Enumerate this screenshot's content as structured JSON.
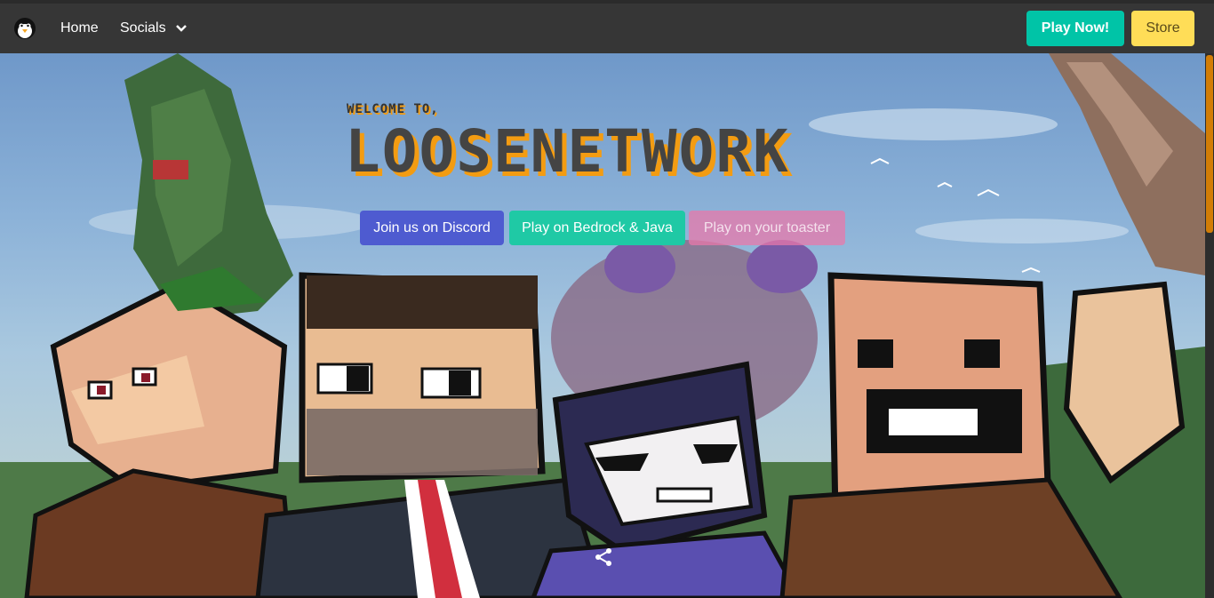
{
  "navbar": {
    "logo_icon": "penguin-logo-icon",
    "home_label": "Home",
    "socials_label": "Socials",
    "play_now_label": "Play Now!",
    "store_label": "Store"
  },
  "hero": {
    "welcome_text": "WELCOME TO,",
    "brand_title": "LOOSENETWORK",
    "buttons": [
      {
        "label": "Join us on Discord"
      },
      {
        "label": "Play on Bedrock & Java"
      },
      {
        "label": "Play on your toaster"
      }
    ]
  },
  "colors": {
    "navbar_bg": "#363636",
    "play_now": "#00c4a7",
    "store": "#ffdd57",
    "discord": "#4e5bd0",
    "bedrock": "#1fc9a5",
    "toaster": "#e878aa",
    "title_shadow": "#f39c12"
  }
}
